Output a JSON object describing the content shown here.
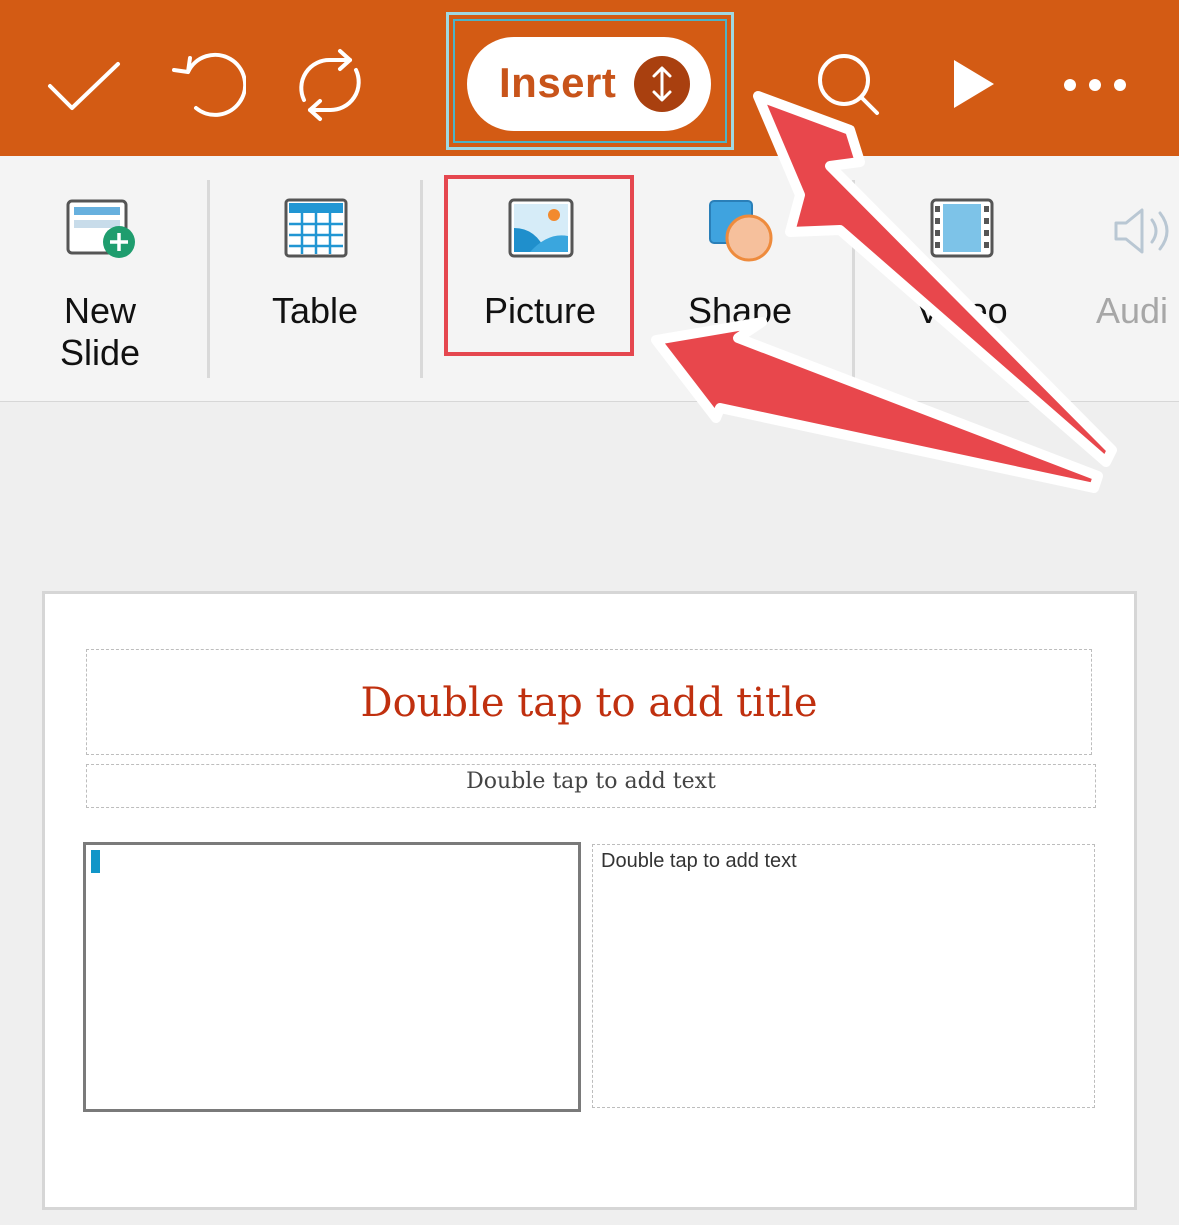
{
  "toolbar": {
    "done_icon": "checkmark-icon",
    "undo_icon": "undo-icon",
    "sync_icon": "sync-icon",
    "insert_label": "Insert",
    "search_icon": "search-icon",
    "play_icon": "play-icon",
    "more_icon": "more-icon",
    "bar_color": "#d35b14"
  },
  "ribbon": {
    "items": [
      {
        "label": "New\nSlide",
        "icon": "new-slide-icon"
      },
      {
        "label": "Table",
        "icon": "table-icon"
      },
      {
        "label": "Picture",
        "icon": "picture-icon"
      },
      {
        "label": "Shape",
        "icon": "shape-icon"
      },
      {
        "label": "Video",
        "icon": "video-icon"
      },
      {
        "label": "Audi",
        "icon": "audio-icon"
      }
    ]
  },
  "slide": {
    "title_placeholder": "Double tap to add title",
    "subtitle_placeholder": "Double tap to add text",
    "content_placeholder": "Double tap to add text"
  }
}
